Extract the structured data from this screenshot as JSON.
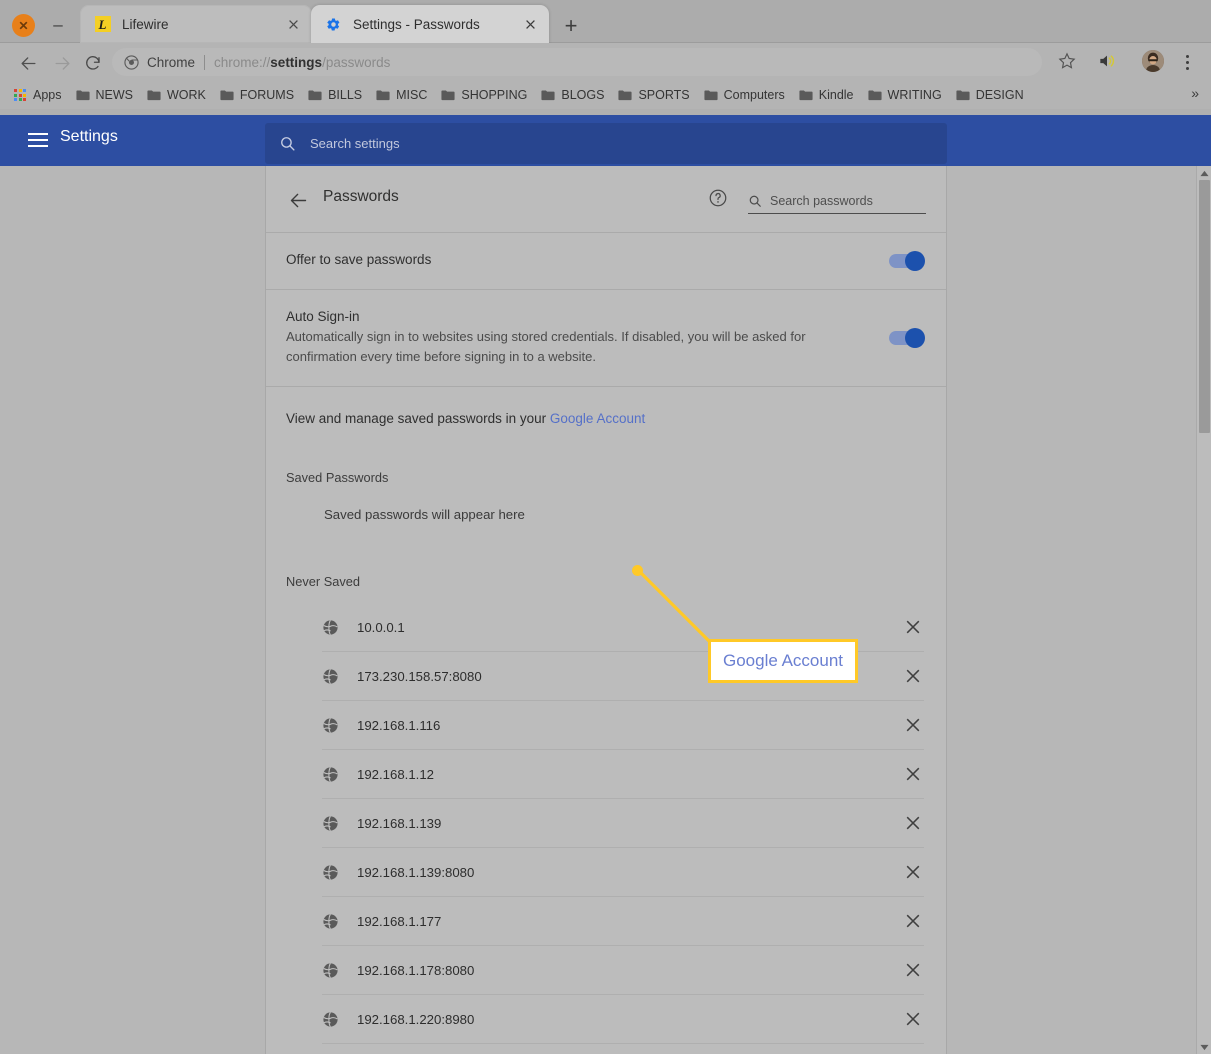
{
  "window": {
    "close_label": "close-window",
    "minimize_label": "minimize-window"
  },
  "tabs": [
    {
      "title": "Lifewire",
      "favicon": "lifewire-letter-l-icon",
      "favicon_letter": "L",
      "active": false,
      "close_label": "×"
    },
    {
      "title": "Settings - Passwords",
      "favicon": "blue-gear-icon",
      "active": true,
      "close_label": "×"
    }
  ],
  "new_tab_label": "+",
  "toolbar": {
    "back_label": "back-navigation",
    "forward_label": "forward-navigation",
    "reload_label": "reload-page",
    "omnibox": {
      "chrome_icon": "chrome-logo-icon",
      "scheme_label": "Chrome",
      "url_prefix": "chrome://",
      "url_bold": "settings",
      "url_suffix": "/passwords",
      "full_url": "chrome://settings/passwords"
    },
    "star_label": "bookmark-this-page",
    "volume_label": "tab-audio-muted",
    "avatar_label": "user-profile-avatar",
    "menu_label": "chrome-main-menu"
  },
  "bookmarks": {
    "apps_label": "Apps",
    "apps_icon": "apps-grid-icon",
    "apps_colors": [
      "#d94235",
      "#f5b400",
      "#4a8cf5",
      "#35a853",
      "#d94235",
      "#f5b400",
      "#4a8cf5",
      "#35a853",
      "#d94235"
    ],
    "items": [
      {
        "label": "NEWS",
        "icon": "folder-icon"
      },
      {
        "label": "WORK",
        "icon": "folder-icon"
      },
      {
        "label": "FORUMS",
        "icon": "folder-icon"
      },
      {
        "label": "BILLS",
        "icon": "folder-icon"
      },
      {
        "label": "MISC",
        "icon": "folder-icon"
      },
      {
        "label": "SHOPPING",
        "icon": "folder-icon"
      },
      {
        "label": "BLOGS",
        "icon": "folder-icon"
      },
      {
        "label": "SPORTS",
        "icon": "folder-icon"
      },
      {
        "label": "Computers",
        "icon": "folder-icon"
      },
      {
        "label": "Kindle",
        "icon": "folder-icon"
      },
      {
        "label": "WRITING",
        "icon": "folder-icon"
      },
      {
        "label": "DESIGN",
        "icon": "folder-icon"
      }
    ],
    "overflow_label": "»"
  },
  "settings": {
    "header": {
      "menu_icon": "hamburger-menu-icon",
      "title": "Settings",
      "search_icon": "search-icon",
      "search_placeholder": "Search settings",
      "bg_color": "#2d4ea2"
    },
    "subheader": {
      "back_icon": "back-arrow-icon",
      "page_title": "Passwords",
      "help_icon": "help-question-icon",
      "search_icon": "search-icon",
      "search_placeholder": "Search passwords"
    },
    "offer_to_save": {
      "label": "Offer to save passwords",
      "toggle_state": "on",
      "toggle_color": "#1c51ad"
    },
    "auto_signin": {
      "label": "Auto Sign-in",
      "description": "Automatically sign in to websites using stored credentials. If disabled, you will be asked for confirmation every time before signing in to a website.",
      "toggle_state": "on",
      "toggle_color": "#1c51ad"
    },
    "manage_row": {
      "text_before": "View and manage saved passwords in your ",
      "link_label": "Google Account",
      "link_color": "#5570c8"
    },
    "saved_passwords": {
      "section_title": "Saved Passwords",
      "empty_message": "Saved passwords will appear here"
    },
    "never_saved": {
      "section_title": "Never Saved",
      "rows": [
        {
          "site": "10.0.0.1",
          "icon": "globe-icon",
          "remove_label": "×"
        },
        {
          "site": "173.230.158.57:8080",
          "icon": "globe-icon",
          "remove_label": "×"
        },
        {
          "site": "192.168.1.116",
          "icon": "globe-icon",
          "remove_label": "×"
        },
        {
          "site": "192.168.1.12",
          "icon": "globe-icon",
          "remove_label": "×"
        },
        {
          "site": "192.168.1.139",
          "icon": "globe-icon",
          "remove_label": "×"
        },
        {
          "site": "192.168.1.139:8080",
          "icon": "globe-icon",
          "remove_label": "×"
        },
        {
          "site": "192.168.1.177",
          "icon": "globe-icon",
          "remove_label": "×"
        },
        {
          "site": "192.168.1.178:8080",
          "icon": "globe-icon",
          "remove_label": "×"
        },
        {
          "site": "192.168.1.220:8980",
          "icon": "globe-icon",
          "remove_label": "×"
        }
      ]
    }
  },
  "annotation": {
    "callout_label": "Google Account",
    "dot_color": "#ffc927",
    "border_color": "#ffc927",
    "text_color": "#6a7fd1",
    "box_background": "#ffffff"
  },
  "scrollbar": {
    "up_label": "▲",
    "down_label": "▼",
    "thumb_label": "vertical-scroll-thumb"
  }
}
